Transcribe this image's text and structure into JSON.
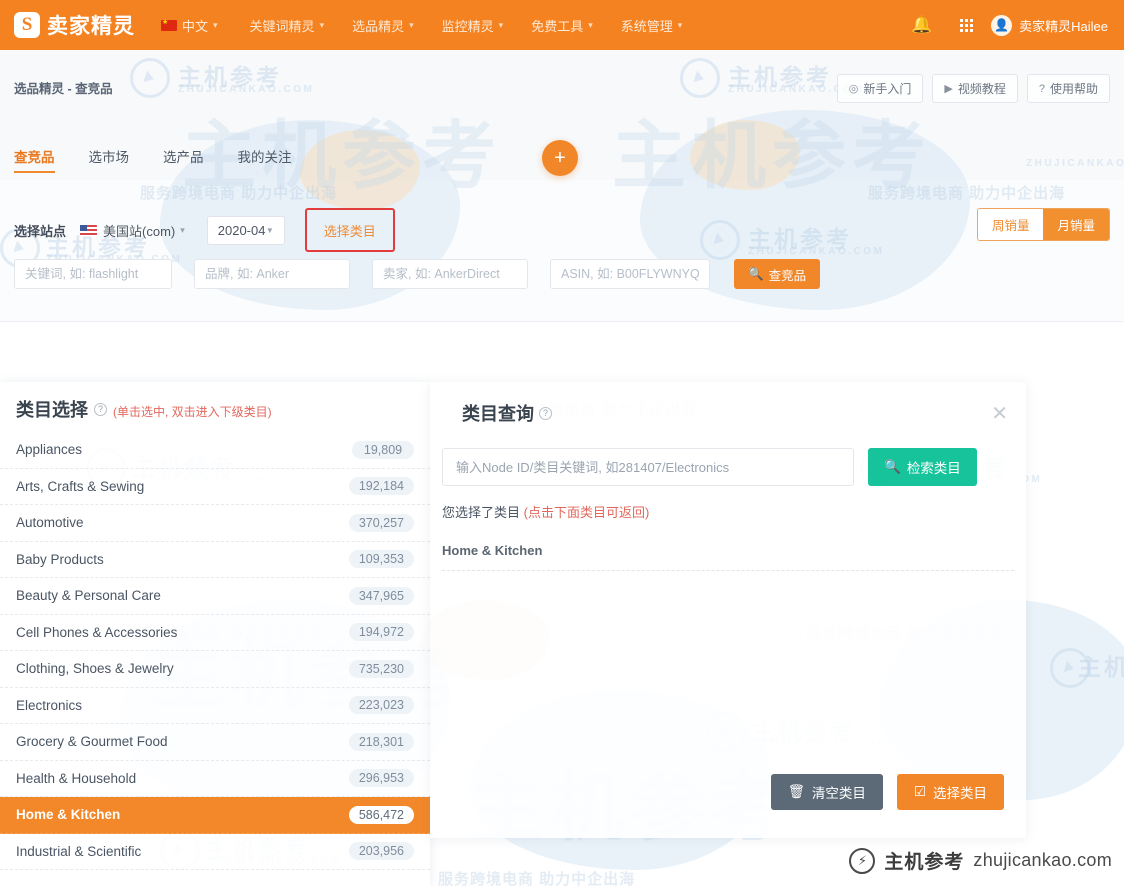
{
  "header": {
    "logo_text": "卖家精灵",
    "logo_mark": "S",
    "lang": "中文",
    "nav": [
      {
        "label": "关键词精灵"
      },
      {
        "label": "选品精灵"
      },
      {
        "label": "监控精灵"
      },
      {
        "label": "免费工具"
      },
      {
        "label": "系统管理"
      }
    ],
    "bell_icon": "notification-bell-icon",
    "apps_icon": "apps-grid-icon",
    "username": "卖家精灵Hailee"
  },
  "page": {
    "breadcrumb": "选品精灵 - 查竞品",
    "help_buttons": [
      {
        "label": "新手入门",
        "icon": "compass-icon"
      },
      {
        "label": "视频教程",
        "icon": "play-circle-icon"
      },
      {
        "label": "使用帮助",
        "icon": "question-circle-icon"
      }
    ],
    "tabs": [
      {
        "label": "查竞品",
        "active": true
      },
      {
        "label": "选市场",
        "active": false
      },
      {
        "label": "选产品",
        "active": false
      },
      {
        "label": "我的关注",
        "active": false
      }
    ],
    "fab_label": "+"
  },
  "filters": {
    "site_label": "选择站点",
    "site_value": "美国站(com)",
    "month_value": "2020-04",
    "category_button": "选择类目",
    "sales_toggle": [
      {
        "label": "周销量",
        "active": false
      },
      {
        "label": "月销量",
        "active": true
      }
    ],
    "inputs": {
      "keyword_placeholder": "关键词, 如: flashlight",
      "keyword_value": "",
      "brand_placeholder": "品牌, 如: Anker",
      "brand_value": "",
      "seller_placeholder": "卖家, 如: AnkerDirect",
      "seller_value": "",
      "asin_placeholder": "ASIN, 如: B00FLYWNYQ",
      "asin_value": ""
    },
    "search_button": "查竞品"
  },
  "category_panel": {
    "title": "类目选择",
    "hint": "(单击选中, 双击进入下级类目)",
    "rows": [
      {
        "name": "Appliances",
        "count": "19,809",
        "selected": false
      },
      {
        "name": "Arts, Crafts & Sewing",
        "count": "192,184",
        "selected": false
      },
      {
        "name": "Automotive",
        "count": "370,257",
        "selected": false
      },
      {
        "name": "Baby Products",
        "count": "109,353",
        "selected": false
      },
      {
        "name": "Beauty & Personal Care",
        "count": "347,965",
        "selected": false
      },
      {
        "name": "Cell Phones & Accessories",
        "count": "194,972",
        "selected": false
      },
      {
        "name": "Clothing, Shoes & Jewelry",
        "count": "735,230",
        "selected": false
      },
      {
        "name": "Electronics",
        "count": "223,023",
        "selected": false
      },
      {
        "name": "Grocery & Gourmet Food",
        "count": "218,301",
        "selected": false
      },
      {
        "name": "Health & Household",
        "count": "296,953",
        "selected": false
      },
      {
        "name": "Home & Kitchen",
        "count": "586,472",
        "selected": true
      },
      {
        "name": "Industrial & Scientific",
        "count": "203,956",
        "selected": false
      }
    ]
  },
  "modal": {
    "title": "类目查询",
    "close_icon": "close-icon",
    "node_placeholder": "输入Node ID/类目关键词, 如281407/Electronics",
    "node_value": "",
    "search_button": "检索类目",
    "selected_note_main": "您选择了类目",
    "selected_note_red": "(点击下面类目可返回)",
    "selected_category": "Home & Kitchen",
    "clear_button": "清空类目",
    "choose_button": "选择类目"
  },
  "brand": {
    "cn": "主机参考",
    "en": "zhujicankao.com"
  },
  "watermark": {
    "cn": "主机参考",
    "domain": "ZHUJICANKAO.COM",
    "tagline": "服务跨境电商 助力中企出海"
  },
  "colors": {
    "brand_orange": "#f58220",
    "accent_orange": "#f2872a",
    "teal": "#16c39a",
    "slate": "#5c6a78",
    "red_highlight": "#e23c3c",
    "hint_red": "#e2685d"
  }
}
